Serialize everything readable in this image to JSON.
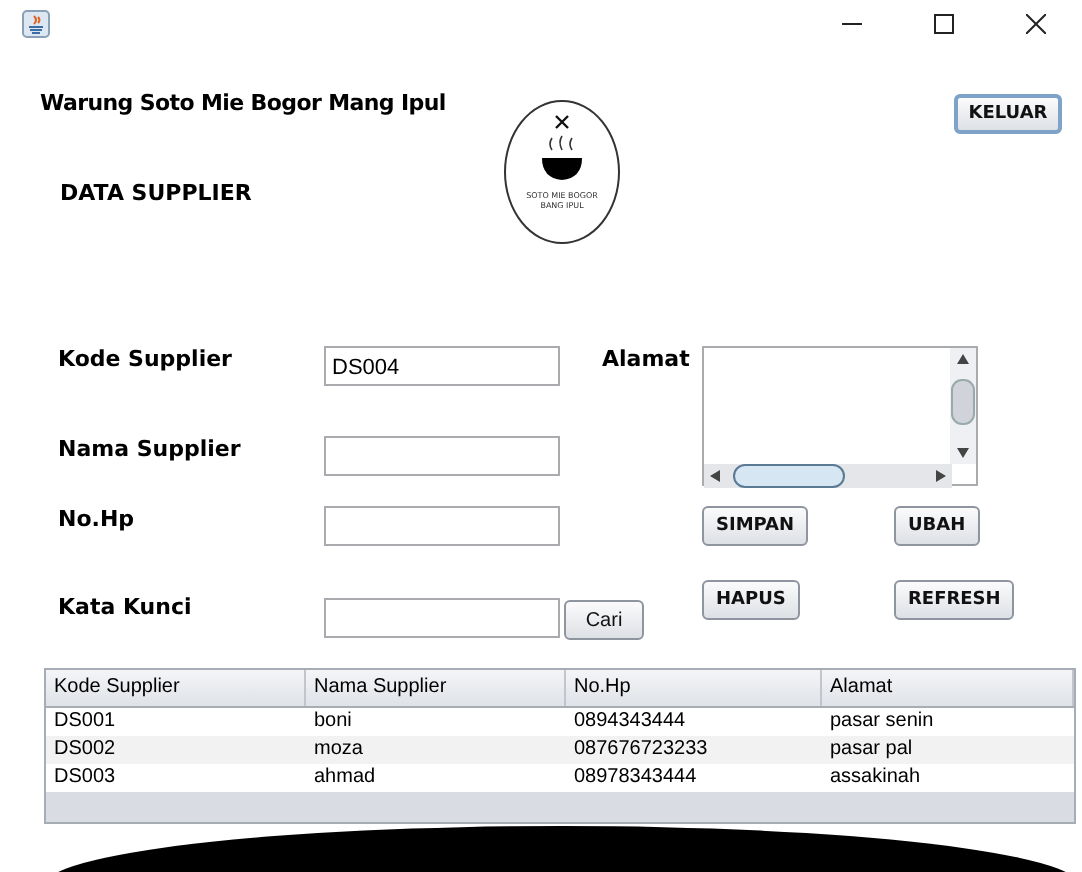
{
  "window": {
    "controls": [
      {
        "kind": "minimize"
      },
      {
        "kind": "maximize"
      },
      {
        "kind": "close"
      }
    ]
  },
  "header": {
    "store_name": "Warung Soto Mie Bogor Mang Ipul",
    "page_title": "DATA SUPPLIER",
    "logo": {
      "lines": [
        "SOTO MIE BOGOR",
        "BANG IPUL"
      ]
    },
    "exit_button": "KELUAR"
  },
  "form": {
    "kode_supplier": {
      "label": "Kode Supplier",
      "value": "DS004"
    },
    "nama_supplier": {
      "label": "Nama Supplier"
    },
    "no_hp": {
      "label": "No.Hp"
    },
    "alamat": {
      "label": "Alamat"
    },
    "kata_kunci": {
      "label": "Kata Kunci"
    },
    "search_button": "Cari",
    "buttons": [
      "SIMPAN",
      "UBAH",
      "HAPUS",
      "REFRESH"
    ]
  },
  "table": {
    "columns": [
      "Kode Supplier",
      "Nama Supplier",
      "No.Hp",
      "Alamat"
    ],
    "rows": [
      [
        "DS001",
        "boni",
        "0894343444",
        "pasar senin"
      ],
      [
        "DS002",
        "moza",
        "087676723233",
        "pasar pal"
      ],
      [
        "DS003",
        "ahmad",
        "08978343444",
        "assakinah"
      ]
    ]
  }
}
